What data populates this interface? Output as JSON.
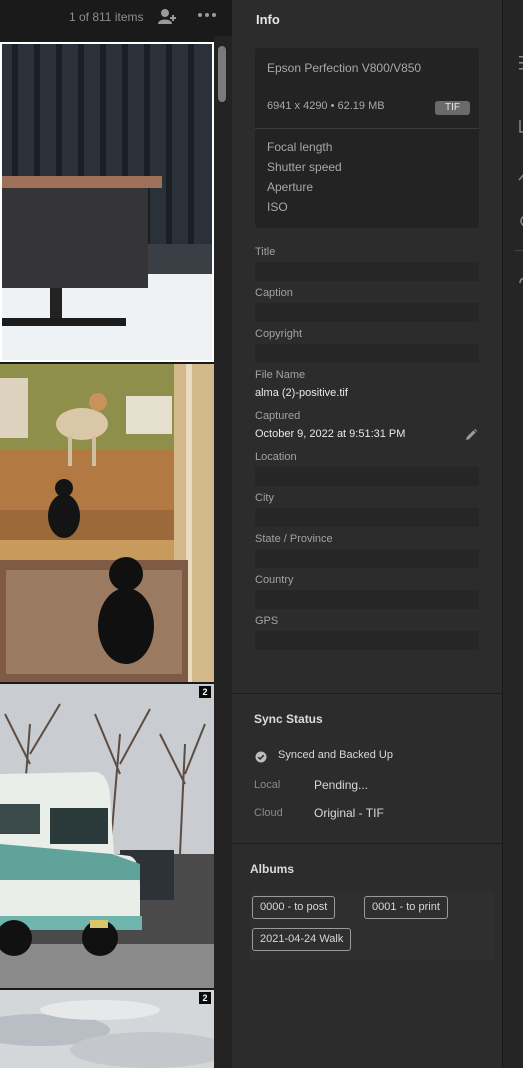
{
  "grid": {
    "items_count": "1 of 811 items",
    "thumbnails": [
      {
        "name": "bench",
        "badge": ""
      },
      {
        "name": "dog-and-cats",
        "badge": ""
      },
      {
        "name": "vintage-truck",
        "badge": "2"
      },
      {
        "name": "sky",
        "badge": "2"
      }
    ]
  },
  "info": {
    "title": "Info",
    "camera_model": "Epson Perfection V800/V850",
    "dimensions": "6941 x 4290  •  62.19 MB",
    "file_type": "TIF",
    "exif": {
      "focal_length": "Focal length",
      "shutter_speed": "Shutter speed",
      "aperture": "Aperture",
      "iso": "ISO"
    },
    "fields": {
      "title_label": "Title",
      "caption_label": "Caption",
      "copyright_label": "Copyright",
      "file_name_label": "File Name",
      "file_name_value": "alma (2)-positive.tif",
      "captured_label": "Captured",
      "captured_value": "October 9, 2022 at 9:51:31 PM",
      "location_label": "Location",
      "city_label": "City",
      "state_label": "State / Province",
      "country_label": "Country",
      "gps_label": "GPS"
    }
  },
  "sync": {
    "title": "Sync Status",
    "status": "Synced and Backed Up",
    "local_label": "Local",
    "local_value": "Pending...",
    "cloud_label": "Cloud",
    "cloud_value": "Original - TIF"
  },
  "albums": {
    "title": "Albums",
    "items": [
      "0000 - to post",
      "0001 - to print",
      "2021-04-24 Walk"
    ]
  },
  "icons": {
    "add_person": "add-person-icon",
    "more": "more-icon",
    "pencil": "pencil-icon",
    "check": "check-circle-icon"
  },
  "colors": {
    "panel_bg": "#2c2c2c",
    "selection_border": "#ffffff"
  }
}
